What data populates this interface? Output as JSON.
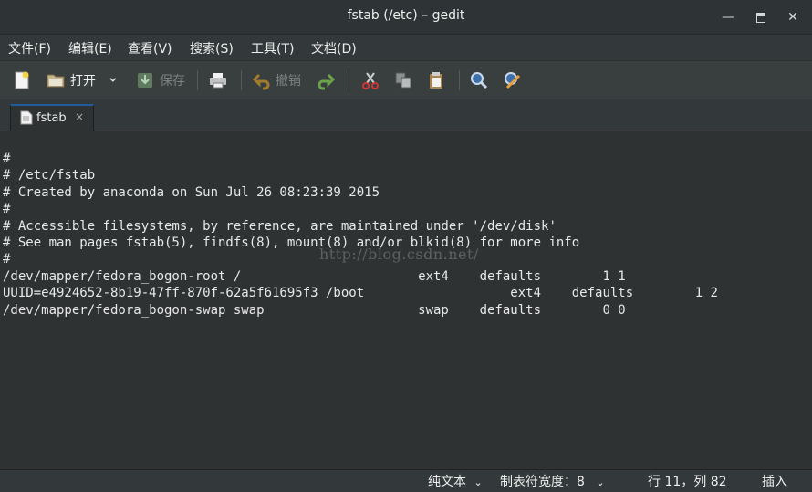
{
  "window": {
    "title": "fstab (/etc) – gedit"
  },
  "menubar": {
    "items": [
      "文件(F)",
      "编辑(E)",
      "查看(V)",
      "搜索(S)",
      "工具(T)",
      "文档(D)"
    ]
  },
  "toolbar": {
    "open_label": "打开",
    "save_label": "保存",
    "undo_label": "撤销"
  },
  "tabs": [
    {
      "label": "fstab",
      "close": "×"
    }
  ],
  "editor": {
    "lines": [
      "#",
      "# /etc/fstab",
      "# Created by anaconda on Sun Jul 26 08:23:39 2015",
      "#",
      "# Accessible filesystems, by reference, are maintained under '/dev/disk'",
      "# See man pages fstab(5), findfs(8), mount(8) and/or blkid(8) for more info",
      "#",
      "/dev/mapper/fedora_bogon-root /                       ext4    defaults        1 1",
      "UUID=e4924652-8b19-47ff-870f-62a5f61695f3 /boot                   ext4    defaults        1 2",
      "/dev/mapper/fedora_bogon-swap swap                    swap    defaults        0 0"
    ],
    "watermark": "http://blog.csdn.net/"
  },
  "statusbar": {
    "language": "纯文本",
    "tab_width": "制表符宽度：8",
    "position": "行 11，列 82",
    "mode": "插入"
  }
}
